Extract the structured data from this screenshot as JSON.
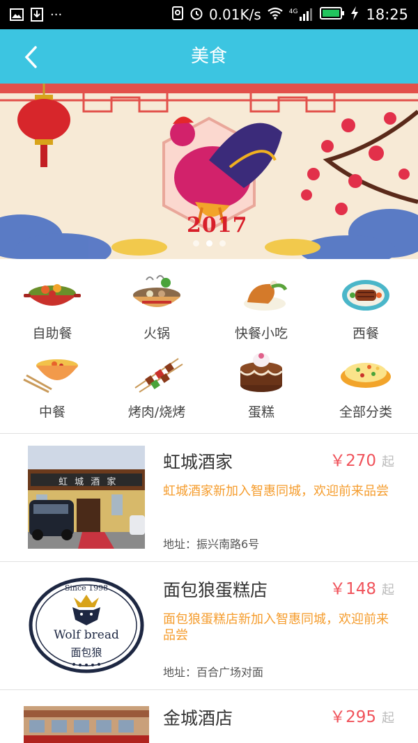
{
  "status_bar": {
    "speed": "0.01K/s",
    "time": "18:25",
    "net_label": "4G",
    "more": "···"
  },
  "header": {
    "title": "美食"
  },
  "banner": {
    "year": "2017",
    "slide_count": 3,
    "active_slide": 2
  },
  "categories": [
    {
      "label": "自助餐",
      "icon": "buffet-pot-icon"
    },
    {
      "label": "火锅",
      "icon": "hotpot-icon"
    },
    {
      "label": "快餐小吃",
      "icon": "fried-chicken-icon"
    },
    {
      "label": "西餐",
      "icon": "steak-plate-icon"
    },
    {
      "label": "中餐",
      "icon": "soup-bowl-chopsticks-icon"
    },
    {
      "label": "烤肉/烧烤",
      "icon": "skewers-icon"
    },
    {
      "label": "蛋糕",
      "icon": "cake-icon"
    },
    {
      "label": "全部分类",
      "icon": "fried-rice-icon"
    }
  ],
  "shops": [
    {
      "name": "虹城酒家",
      "price": "￥270",
      "price_unit": "起",
      "desc": "虹城酒家新加入智惠同城，欢迎前来品尝",
      "address": "地址：振兴南路6号",
      "sign_text": "虹 城 酒 家"
    },
    {
      "name": "面包狼蛋糕店",
      "price": "￥148",
      "price_unit": "起",
      "desc": "面包狼蛋糕店新加入智惠同城，欢迎前来品尝",
      "address": "地址：百合广场对面",
      "logo_since": "Since 1998",
      "logo_en": "Wolf bread",
      "logo_cn": "面包狼"
    },
    {
      "name": "金城酒店",
      "price": "￥295",
      "price_unit": "起",
      "desc": "",
      "address": ""
    }
  ],
  "colors": {
    "accent": "#3cc5e1",
    "price": "#f0525a",
    "desc": "#f59c2c"
  }
}
